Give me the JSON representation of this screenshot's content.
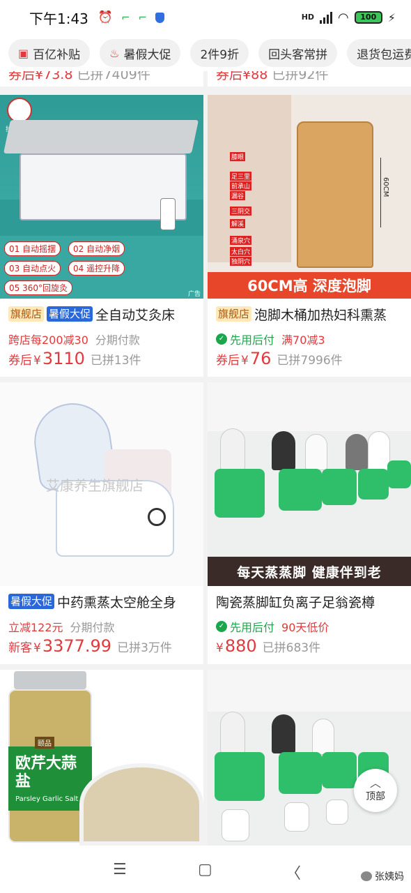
{
  "status_bar": {
    "time": "下午1:43",
    "hd_label": "HD",
    "battery": "100"
  },
  "chips": [
    {
      "icon": "wallet-icon",
      "label": "百亿补贴"
    },
    {
      "icon": "flame-icon",
      "label": "暑假大促"
    },
    {
      "icon": "",
      "label": "2件9折"
    },
    {
      "icon": "",
      "label": "回头客常拼"
    },
    {
      "icon": "",
      "label": "退货包运费"
    }
  ],
  "prev_row": {
    "left": {
      "coupon": "券后",
      "price": "¥73.8",
      "sold": "已拼7409件"
    },
    "right": {
      "coupon": "券后",
      "price": "¥88",
      "sold": "已拼92件"
    }
  },
  "products": [
    {
      "tags": [
        {
          "type": "flag",
          "text": "旗舰店"
        },
        {
          "type": "summer",
          "text": "暑假大促"
        }
      ],
      "title": "全自动艾灸床",
      "promo": [
        {
          "text": "跨店每200减30",
          "style": "red"
        },
        {
          "text": "分期付款",
          "style": "gray"
        }
      ],
      "price_prefix": "券后",
      "currency": "¥",
      "price": "3110",
      "sold": "已拼13件",
      "image": {
        "brand": "扶艾堂",
        "ad_label": "广告",
        "features": [
          "01 自动摇摆",
          "02 自动净烟",
          "03 自动点火",
          "04 遥控升降",
          "05 360°回旋灸"
        ]
      }
    },
    {
      "tags": [
        {
          "type": "flag",
          "text": "旗舰店"
        }
      ],
      "title": "泡脚木桶加热妇科熏蒸",
      "promo": [
        {
          "text": "先用后付",
          "style": "green",
          "icon": true
        },
        {
          "text": "满70减3",
          "style": "red"
        }
      ],
      "price_prefix": "券后",
      "currency": "¥",
      "price": "76",
      "sold": "已拼7996件",
      "image": {
        "banner": "60CM高 深度泡脚",
        "height_label": "60CM",
        "points": [
          "膝眼",
          "足三里",
          "前承山",
          "漏谷",
          "三阴交",
          "解溪",
          "涌泉穴",
          "太白穴",
          "独阴穴"
        ]
      }
    },
    {
      "tags": [
        {
          "type": "summer",
          "text": "暑假大促"
        }
      ],
      "title": "中药熏蒸太空舱全身",
      "promo": [
        {
          "text": "立减122元",
          "style": "red"
        },
        {
          "text": "分期付款",
          "style": "gray"
        }
      ],
      "price_prefix": "新客",
      "currency": "¥",
      "price": "3377.99",
      "sold": "已拼3万件",
      "image": {
        "watermark": "艾康养生旗舰店"
      }
    },
    {
      "tags": [],
      "title": "陶瓷蒸脚缸负离子足翁瓷樽",
      "promo": [
        {
          "text": "先用后付",
          "style": "green",
          "icon": true
        },
        {
          "text": "90天低价",
          "style": "red"
        }
      ],
      "price_prefix": "",
      "currency": "¥",
      "price": "880",
      "sold": "已拼683件",
      "image": {
        "banner": "每天蒸蒸脚 健康伴到老"
      }
    },
    {
      "image": {
        "jar_label": "欧芹大蒜盐",
        "jar_brand": "颐品",
        "jar_en": "Parsley Garlic Salt"
      }
    },
    {
      "image": {}
    }
  ],
  "back_to_top": "顶部",
  "watermark": "张姨妈",
  "colors": {
    "accent_red": "#e4393c",
    "green": "#1aa74b",
    "summer_blue": "#2a67d8",
    "flag_bg": "#ffe9b8"
  }
}
